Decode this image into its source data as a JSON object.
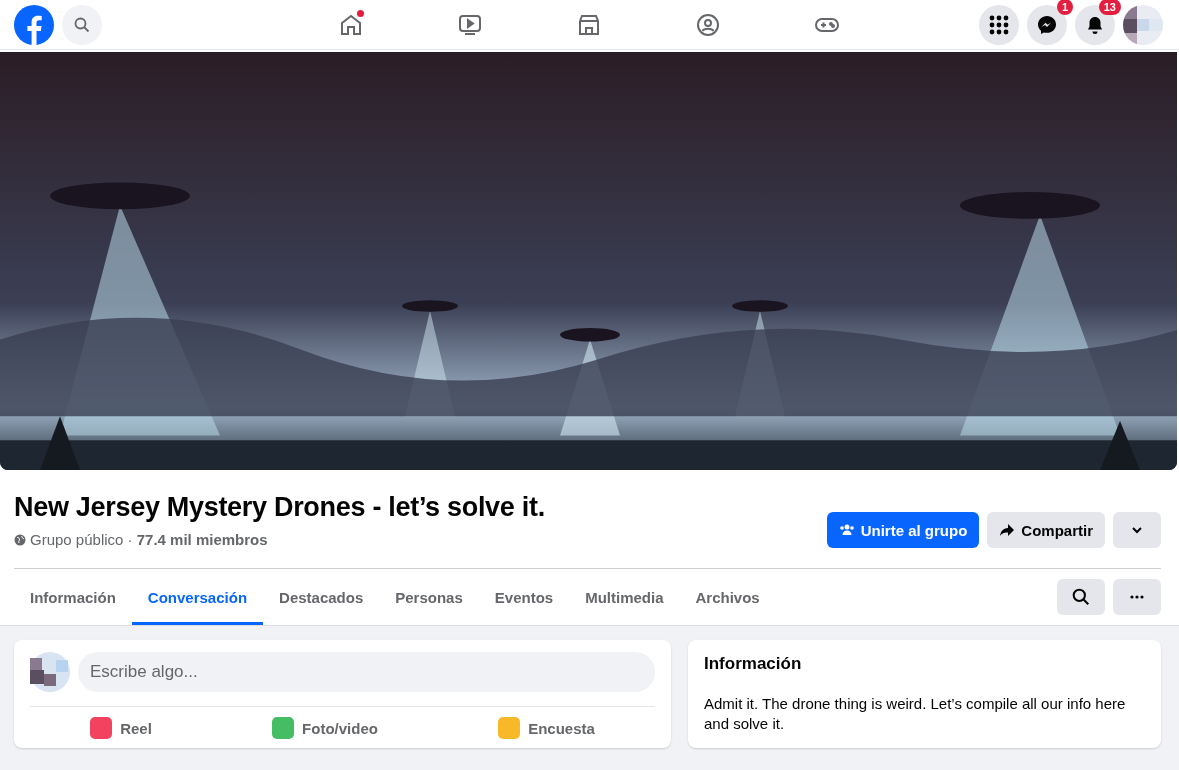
{
  "top_bar": {
    "nav": [
      {
        "kind": "home",
        "selected": false,
        "dot": true
      },
      {
        "kind": "video",
        "selected": false,
        "dot": false
      },
      {
        "kind": "market",
        "selected": false,
        "dot": false
      },
      {
        "kind": "groups",
        "selected": false,
        "dot": false
      },
      {
        "kind": "gaming",
        "selected": false,
        "dot": false
      }
    ],
    "right": [
      {
        "kind": "menu"
      },
      {
        "kind": "messenger",
        "badge": "1"
      },
      {
        "kind": "bell",
        "badge": "13"
      }
    ]
  },
  "group": {
    "title": "New Jersey Mystery Drones - let’s solve it.",
    "meta": "Grupo público · **77.4 mil miembros**"
  },
  "buttons": [
    {
      "kind": "join",
      "label": "Unirte al grupo"
    },
    {
      "kind": "share",
      "label": "Compartir"
    },
    {
      "kind": "more"
    }
  ],
  "tabs": [
    {
      "label": "Información",
      "selected": false
    },
    {
      "label": "Conversación",
      "selected": true
    },
    {
      "label": "Destacados",
      "selected": false
    },
    {
      "label": "Personas",
      "selected": false
    },
    {
      "label": "Eventos",
      "selected": false
    },
    {
      "label": "Multimedia",
      "selected": false
    },
    {
      "label": "Archivos",
      "selected": false
    }
  ],
  "composer": {
    "placeholder": "Escribe algo...",
    "actions": [
      {
        "kind": "reel",
        "label": "Reel"
      },
      {
        "label": "Foto/video"
      },
      {
        "kind": "poll",
        "label": "Encuesta"
      }
    ]
  },
  "about": {
    "title": "Información",
    "text": "Admit it. The drone thing is weird. Let’s compile all our info here and solve it."
  }
}
